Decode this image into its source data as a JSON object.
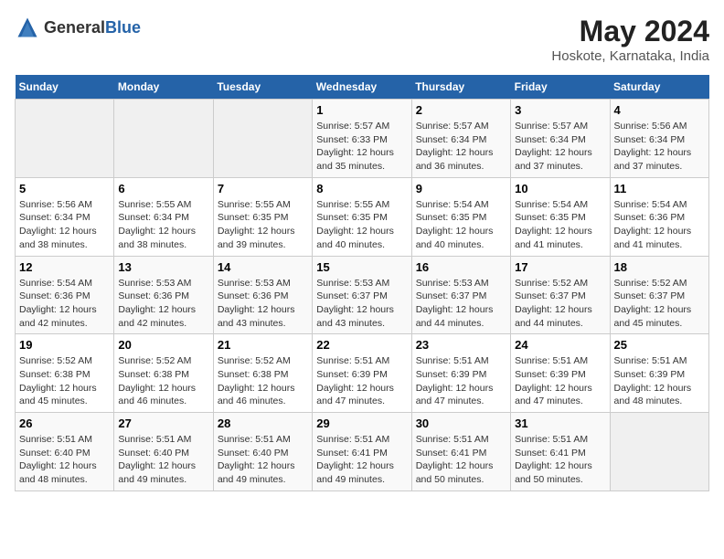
{
  "header": {
    "logo_general": "General",
    "logo_blue": "Blue",
    "title": "May 2024",
    "subtitle": "Hoskote, Karnataka, India"
  },
  "calendar": {
    "days_of_week": [
      "Sunday",
      "Monday",
      "Tuesday",
      "Wednesday",
      "Thursday",
      "Friday",
      "Saturday"
    ],
    "weeks": [
      [
        {
          "day": "",
          "info": ""
        },
        {
          "day": "",
          "info": ""
        },
        {
          "day": "",
          "info": ""
        },
        {
          "day": "1",
          "info": "Sunrise: 5:57 AM\nSunset: 6:33 PM\nDaylight: 12 hours\nand 35 minutes."
        },
        {
          "day": "2",
          "info": "Sunrise: 5:57 AM\nSunset: 6:34 PM\nDaylight: 12 hours\nand 36 minutes."
        },
        {
          "day": "3",
          "info": "Sunrise: 5:57 AM\nSunset: 6:34 PM\nDaylight: 12 hours\nand 37 minutes."
        },
        {
          "day": "4",
          "info": "Sunrise: 5:56 AM\nSunset: 6:34 PM\nDaylight: 12 hours\nand 37 minutes."
        }
      ],
      [
        {
          "day": "5",
          "info": "Sunrise: 5:56 AM\nSunset: 6:34 PM\nDaylight: 12 hours\nand 38 minutes."
        },
        {
          "day": "6",
          "info": "Sunrise: 5:55 AM\nSunset: 6:34 PM\nDaylight: 12 hours\nand 38 minutes."
        },
        {
          "day": "7",
          "info": "Sunrise: 5:55 AM\nSunset: 6:35 PM\nDaylight: 12 hours\nand 39 minutes."
        },
        {
          "day": "8",
          "info": "Sunrise: 5:55 AM\nSunset: 6:35 PM\nDaylight: 12 hours\nand 40 minutes."
        },
        {
          "day": "9",
          "info": "Sunrise: 5:54 AM\nSunset: 6:35 PM\nDaylight: 12 hours\nand 40 minutes."
        },
        {
          "day": "10",
          "info": "Sunrise: 5:54 AM\nSunset: 6:35 PM\nDaylight: 12 hours\nand 41 minutes."
        },
        {
          "day": "11",
          "info": "Sunrise: 5:54 AM\nSunset: 6:36 PM\nDaylight: 12 hours\nand 41 minutes."
        }
      ],
      [
        {
          "day": "12",
          "info": "Sunrise: 5:54 AM\nSunset: 6:36 PM\nDaylight: 12 hours\nand 42 minutes."
        },
        {
          "day": "13",
          "info": "Sunrise: 5:53 AM\nSunset: 6:36 PM\nDaylight: 12 hours\nand 42 minutes."
        },
        {
          "day": "14",
          "info": "Sunrise: 5:53 AM\nSunset: 6:36 PM\nDaylight: 12 hours\nand 43 minutes."
        },
        {
          "day": "15",
          "info": "Sunrise: 5:53 AM\nSunset: 6:37 PM\nDaylight: 12 hours\nand 43 minutes."
        },
        {
          "day": "16",
          "info": "Sunrise: 5:53 AM\nSunset: 6:37 PM\nDaylight: 12 hours\nand 44 minutes."
        },
        {
          "day": "17",
          "info": "Sunrise: 5:52 AM\nSunset: 6:37 PM\nDaylight: 12 hours\nand 44 minutes."
        },
        {
          "day": "18",
          "info": "Sunrise: 5:52 AM\nSunset: 6:37 PM\nDaylight: 12 hours\nand 45 minutes."
        }
      ],
      [
        {
          "day": "19",
          "info": "Sunrise: 5:52 AM\nSunset: 6:38 PM\nDaylight: 12 hours\nand 45 minutes."
        },
        {
          "day": "20",
          "info": "Sunrise: 5:52 AM\nSunset: 6:38 PM\nDaylight: 12 hours\nand 46 minutes."
        },
        {
          "day": "21",
          "info": "Sunrise: 5:52 AM\nSunset: 6:38 PM\nDaylight: 12 hours\nand 46 minutes."
        },
        {
          "day": "22",
          "info": "Sunrise: 5:51 AM\nSunset: 6:39 PM\nDaylight: 12 hours\nand 47 minutes."
        },
        {
          "day": "23",
          "info": "Sunrise: 5:51 AM\nSunset: 6:39 PM\nDaylight: 12 hours\nand 47 minutes."
        },
        {
          "day": "24",
          "info": "Sunrise: 5:51 AM\nSunset: 6:39 PM\nDaylight: 12 hours\nand 47 minutes."
        },
        {
          "day": "25",
          "info": "Sunrise: 5:51 AM\nSunset: 6:39 PM\nDaylight: 12 hours\nand 48 minutes."
        }
      ],
      [
        {
          "day": "26",
          "info": "Sunrise: 5:51 AM\nSunset: 6:40 PM\nDaylight: 12 hours\nand 48 minutes."
        },
        {
          "day": "27",
          "info": "Sunrise: 5:51 AM\nSunset: 6:40 PM\nDaylight: 12 hours\nand 49 minutes."
        },
        {
          "day": "28",
          "info": "Sunrise: 5:51 AM\nSunset: 6:40 PM\nDaylight: 12 hours\nand 49 minutes."
        },
        {
          "day": "29",
          "info": "Sunrise: 5:51 AM\nSunset: 6:41 PM\nDaylight: 12 hours\nand 49 minutes."
        },
        {
          "day": "30",
          "info": "Sunrise: 5:51 AM\nSunset: 6:41 PM\nDaylight: 12 hours\nand 50 minutes."
        },
        {
          "day": "31",
          "info": "Sunrise: 5:51 AM\nSunset: 6:41 PM\nDaylight: 12 hours\nand 50 minutes."
        },
        {
          "day": "",
          "info": ""
        }
      ]
    ]
  },
  "colors": {
    "header_bg": "#2563a8",
    "header_text": "#ffffff",
    "accent": "#2563a8"
  }
}
